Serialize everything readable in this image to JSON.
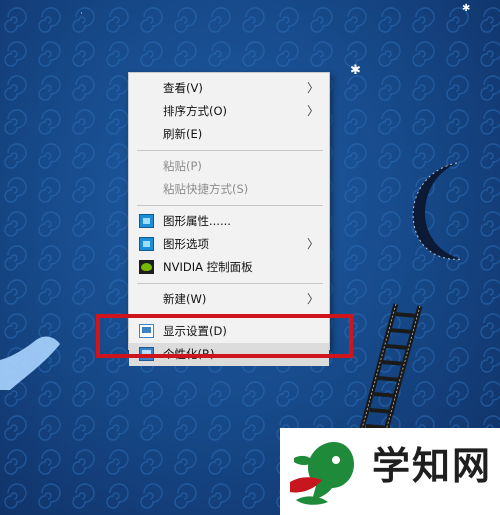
{
  "context_menu": {
    "items": [
      {
        "label": "查看(V)",
        "arrow": "〉"
      },
      {
        "label": "排序方式(O)",
        "arrow": "〉"
      },
      {
        "label": "刷新(E)"
      },
      {
        "label": "粘贴(P)"
      },
      {
        "label": "粘贴快捷方式(S)"
      },
      {
        "label": "图形属性......",
        "icon": "graphics-properties-icon"
      },
      {
        "label": "图形选项",
        "icon": "graphics-options-icon",
        "arrow": "〉"
      },
      {
        "label": "NVIDIA 控制面板",
        "icon": "nvidia-icon"
      },
      {
        "label": "新建(W)",
        "arrow": "〉"
      },
      {
        "label": "显示设置(D)",
        "icon": "display-settings-icon"
      },
      {
        "label": "个性化(R)",
        "icon": "personalize-icon"
      }
    ]
  },
  "watermark": {
    "text": "学知网"
  },
  "colors": {
    "desktop_bg": "#174b8c",
    "menu_bg": "#f2f2f2",
    "highlight_box": "#d0141c",
    "watermark_green": "#1e8a3a"
  }
}
